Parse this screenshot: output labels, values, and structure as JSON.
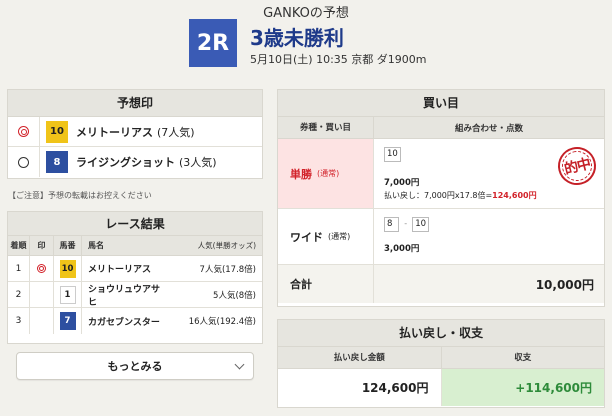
{
  "header": {
    "title": "GANKOの予想",
    "race_no": "2R",
    "race_name": "3歳未勝利",
    "race_info": "5月10日(土) 10:35 京都 ダ1900m"
  },
  "prediction": {
    "title": "予想印",
    "rows": [
      {
        "mark": "double-circle",
        "num": "10",
        "name": "メリトーリアス",
        "pop": "(7人気)"
      },
      {
        "mark": "circle",
        "num": "8",
        "name": "ライジングショット",
        "pop": "(3人気)"
      }
    ]
  },
  "notice": "【ご注意】予想の転載はお控えください",
  "result": {
    "title": "レース結果",
    "headers": {
      "rank": "着順",
      "mark": "印",
      "num": "馬番",
      "name": "馬名",
      "pop": "人気(単勝オッズ)"
    },
    "rows": [
      {
        "rank": "1",
        "mark": "double-circle",
        "num": "10",
        "name": "メリトーリアス",
        "pop": "7人気(17.8倍)"
      },
      {
        "rank": "2",
        "mark": "",
        "num": "1",
        "name": "ショウリュウアサヒ",
        "pop": "5人気(8倍)"
      },
      {
        "rank": "3",
        "mark": "",
        "num": "7",
        "name": "カガセブンスター",
        "pop": "16人気(192.4倍)"
      }
    ],
    "more_label": "もっとみる"
  },
  "bets": {
    "title": "買い目",
    "headers": {
      "type": "券種・買い目",
      "combo": "組み合わせ・点数"
    },
    "win": {
      "type": "単勝",
      "sub": "(通常)",
      "combo": "10",
      "amount": "7,000円",
      "refund_label": "払い戻し：7,000円x17.8倍=",
      "refund_value": "124,600円",
      "stamp": "的中"
    },
    "wide": {
      "type": "ワイド",
      "sub": "(通常)",
      "combo_a": "8",
      "sep": "-",
      "combo_b": "10",
      "amount": "3,000円"
    },
    "total_label": "合計",
    "total_value": "10,000円"
  },
  "payout": {
    "title": "払い戻し・収支",
    "headers": {
      "refund": "払い戻し金額",
      "balance": "収支"
    },
    "refund": "124,600円",
    "balance": "+114,600円"
  },
  "colors": {
    "accent": "#3a5bb5",
    "win_bg": "#fde3e3",
    "red": "#d2222a",
    "gain_bg": "#d8efd0",
    "gain": "#2e8b3a"
  }
}
